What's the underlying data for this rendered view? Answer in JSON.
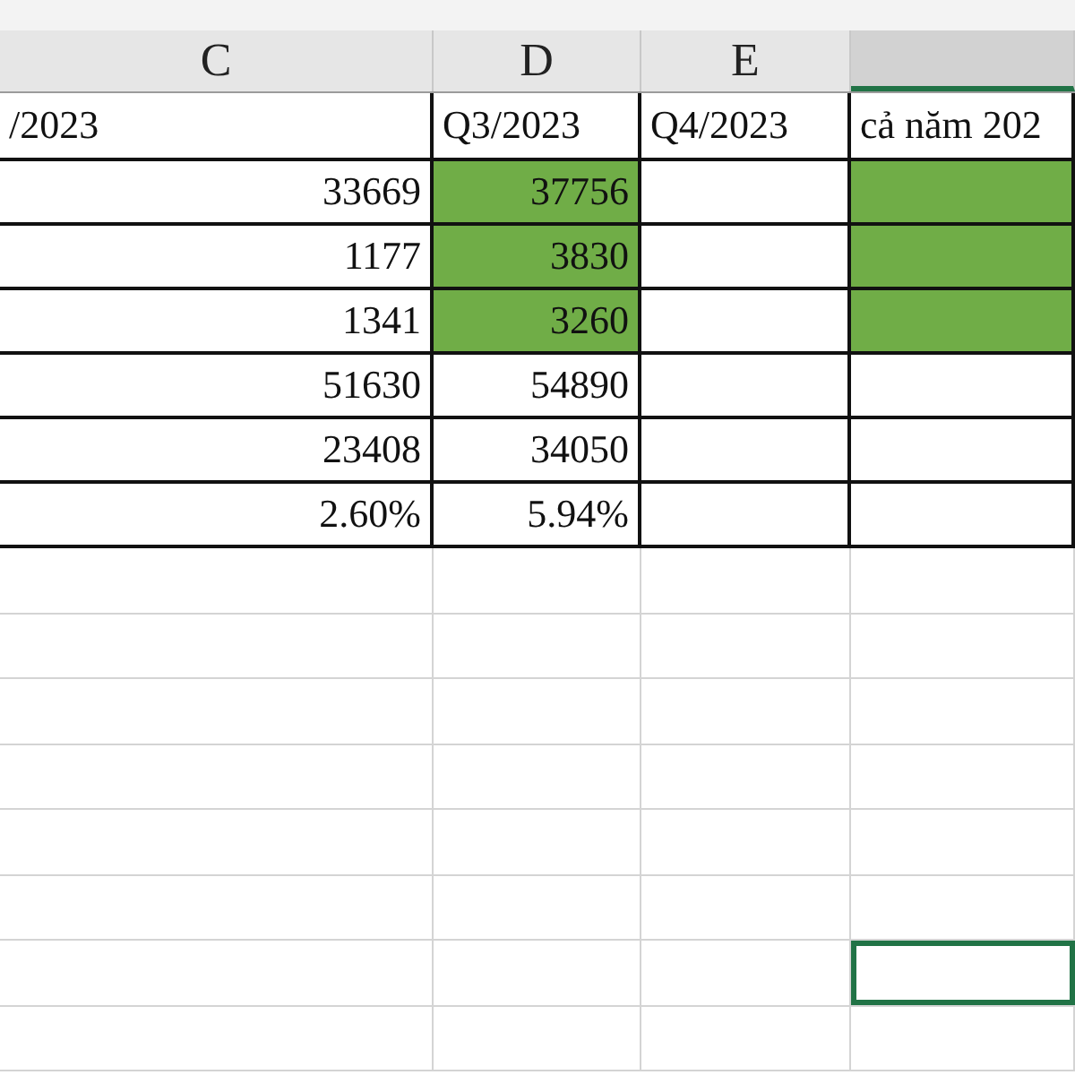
{
  "columns": [
    {
      "letter": "C",
      "selected": false
    },
    {
      "letter": "D",
      "selected": false
    },
    {
      "letter": "E",
      "selected": false
    },
    {
      "selected": true
    }
  ],
  "rows": [
    {
      "cells": [
        {
          "kind": "label",
          "text": "/2023",
          "highlighted": false
        },
        {
          "kind": "label",
          "text": "Q3/2023",
          "highlighted": false
        },
        {
          "kind": "label",
          "text": "Q4/2023",
          "highlighted": false
        },
        {
          "kind": "label",
          "text": "cả năm 202",
          "highlighted": false
        }
      ]
    },
    {
      "cells": [
        {
          "kind": "number",
          "text": "33669",
          "highlighted": false
        },
        {
          "kind": "number",
          "text": "37756",
          "highlighted": true
        },
        {
          "kind": "number",
          "highlighted": false
        },
        {
          "kind": "number",
          "highlighted": true
        }
      ]
    },
    {
      "cells": [
        {
          "kind": "number",
          "text": "1177",
          "highlighted": false
        },
        {
          "kind": "number",
          "text": "3830",
          "highlighted": true
        },
        {
          "kind": "number",
          "highlighted": false
        },
        {
          "kind": "number",
          "highlighted": true
        }
      ]
    },
    {
      "cells": [
        {
          "kind": "number",
          "text": "1341",
          "highlighted": false
        },
        {
          "kind": "number",
          "text": "3260",
          "highlighted": true
        },
        {
          "kind": "number",
          "highlighted": false
        },
        {
          "kind": "number",
          "highlighted": true
        }
      ]
    },
    {
      "cells": [
        {
          "kind": "number",
          "text": "51630",
          "highlighted": false
        },
        {
          "kind": "number",
          "text": "54890",
          "highlighted": false
        },
        {
          "kind": "number",
          "highlighted": false
        },
        {
          "kind": "number",
          "highlighted": false
        }
      ]
    },
    {
      "cells": [
        {
          "kind": "number",
          "text": "23408",
          "highlighted": false
        },
        {
          "kind": "number",
          "text": "34050",
          "highlighted": false
        },
        {
          "kind": "number",
          "highlighted": false
        },
        {
          "kind": "number",
          "highlighted": false
        }
      ]
    },
    {
      "cells": [
        {
          "kind": "number",
          "text": "2.60%",
          "highlighted": false
        },
        {
          "kind": "number",
          "text": "5.94%",
          "highlighted": false
        },
        {
          "kind": "number",
          "highlighted": false
        },
        {
          "kind": "number",
          "highlighted": false
        }
      ]
    }
  ],
  "blank_rows": [
    {
      "selected": false
    },
    {
      "selected": false
    },
    {
      "selected": false
    },
    {
      "selected": false
    },
    {
      "selected": false
    },
    {
      "selected": false
    },
    {
      "selected": true
    },
    {
      "selected": false
    }
  ]
}
